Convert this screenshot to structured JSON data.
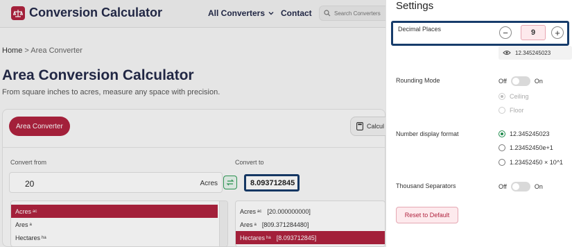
{
  "header": {
    "logo_text": "Conversion Calculator",
    "nav_all_converters": "All Converters",
    "nav_contact": "Contact",
    "search_placeholder": "Search Converters"
  },
  "breadcrumb": {
    "home": "Home",
    "separator": ">",
    "current": "Area Converter"
  },
  "main": {
    "title": "Area Conversion Calculator",
    "subtitle": "From square inches to acres, measure any space with precision.",
    "tab_area": "Area Converter",
    "calc_button": "Calcul",
    "convert_from_label": "Convert from",
    "convert_to_label": "Convert to",
    "from_value": "20",
    "from_unit": "Acres",
    "to_value": "8.093712845",
    "from_list": [
      {
        "name": "Acres",
        "sym": "ac",
        "selected": true
      },
      {
        "name": "Ares",
        "sym": "a",
        "selected": false
      },
      {
        "name": "Hectares",
        "sym": "ha",
        "selected": false
      }
    ],
    "to_list": [
      {
        "name": "Acres",
        "sym": "ac",
        "value": "[20.000000000]",
        "selected": false
      },
      {
        "name": "Ares",
        "sym": "a",
        "value": "[809.371284480]",
        "selected": false
      },
      {
        "name": "Hectares",
        "sym": "ha",
        "value": "[8.093712845]",
        "selected": true
      }
    ]
  },
  "settings": {
    "title": "Settings",
    "decimal_places_label": "Decimal Places",
    "decimal_places_value": "9",
    "preview_value": "12.345245023",
    "rounding_label": "Rounding Mode",
    "rounding_off": "Off",
    "rounding_on": "On",
    "rounding_options": [
      "Ceiling",
      "Floor"
    ],
    "number_format_label": "Number display format",
    "number_format_options": [
      "12.345245023",
      "1.23452450e+1",
      "1.23452450 × 10^1"
    ],
    "thousand_label": "Thousand Separators",
    "thousand_off": "Off",
    "thousand_on": "On",
    "reset_label": "Reset to Default"
  },
  "colors": {
    "brand": "#b0233f",
    "navy": "#242a4a",
    "focus": "#173c6b",
    "radio_green": "#1f8a4c"
  }
}
